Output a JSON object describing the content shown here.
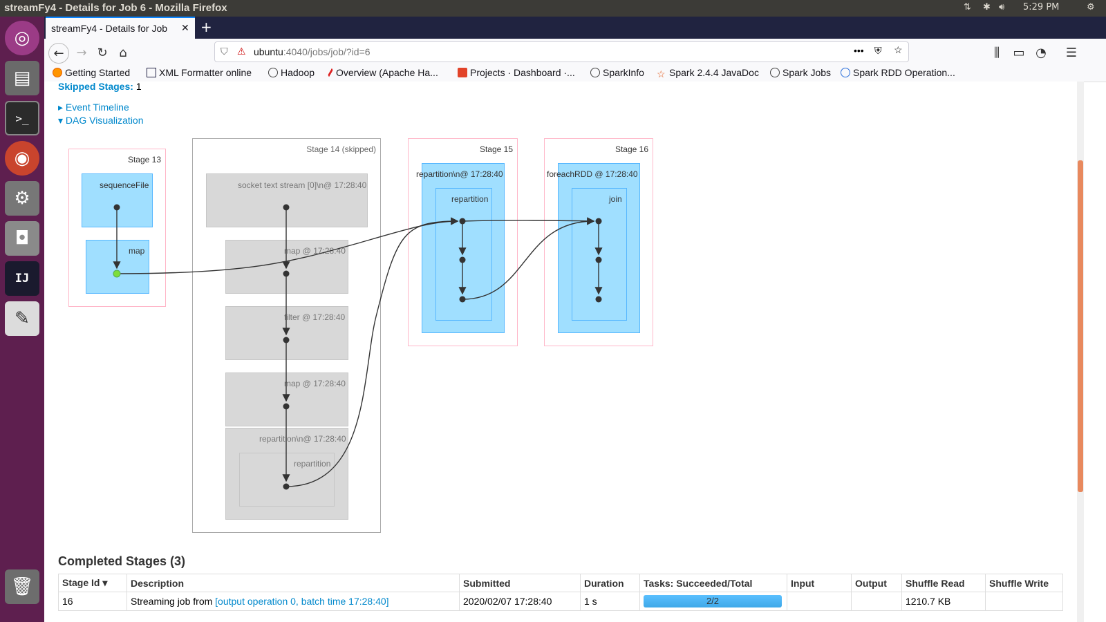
{
  "system": {
    "window_title": "streamFy4 - Details for Job 6 - Mozilla Firefox",
    "time": "5:29 PM"
  },
  "launcher": {
    "items": [
      "Ubuntu",
      "Files",
      "Terminal",
      "Firefox",
      "System Settings",
      "Camera",
      "IntelliJ IDEA",
      "Text Editor",
      "Trash"
    ]
  },
  "browser": {
    "tab_title": "streamFy4 - Details for Job",
    "url_host": "ubuntu",
    "url_rest": ":4040/jobs/job/?id=6",
    "bookmarks": [
      "Getting Started",
      "XML Formatter online",
      "Hadoop",
      "Overview (Apache Ha...",
      "Projects · Dashboard ·...",
      "SparkInfo",
      "Spark 2.4.4 JavaDoc",
      "Spark Jobs",
      "Spark RDD Operation..."
    ]
  },
  "page": {
    "skipped_label": "Skipped Stages:",
    "skipped_count": "1",
    "event_timeline": "Event Timeline",
    "dag_visualization": "DAG Visualization",
    "dag": {
      "stage13": {
        "title": "Stage 13",
        "op1": "sequenceFile",
        "op2": "map"
      },
      "stage14": {
        "title": "Stage 14 (skipped)",
        "op1": "socket text stream [0]\\n@ 17:28:40",
        "op2": "map @ 17:28:40",
        "op3": "filter @ 17:28:40",
        "op4": "map @ 17:28:40",
        "op5": "repartition\\n@ 17:28:40",
        "op5_inner": "repartition"
      },
      "stage15": {
        "title": "Stage 15",
        "op1": "repartition\\n@ 17:28:40",
        "op1_inner": "repartition"
      },
      "stage16": {
        "title": "Stage 16",
        "op1": "foreachRDD @ 17:28:40",
        "op1_inner": "join"
      }
    },
    "completed_title": "Completed Stages (3)",
    "table": {
      "headers": [
        "Stage Id ▾",
        "Description",
        "Submitted",
        "Duration",
        "Tasks: Succeeded/Total",
        "Input",
        "Output",
        "Shuffle Read",
        "Shuffle Write"
      ],
      "rows": [
        {
          "id": "16",
          "desc_prefix": "Streaming job from ",
          "desc_link": "[output operation 0, batch time 17:28:40]",
          "submitted": "2020/02/07 17:28:40",
          "duration": "1 s",
          "tasks": "2/2",
          "tasks_fraction": 1.0,
          "input": "",
          "output": "",
          "shuffle_read": "1210.7 KB",
          "shuffle_write": ""
        }
      ]
    }
  },
  "colors": {
    "link": "#0088cc",
    "stage_border": "#ffb6c8",
    "op_blue": "#a0dfff",
    "op_gray": "#d8d8d8",
    "launcher_bg": "#5e1f4f",
    "scroll_thumb": "#e8895e"
  }
}
